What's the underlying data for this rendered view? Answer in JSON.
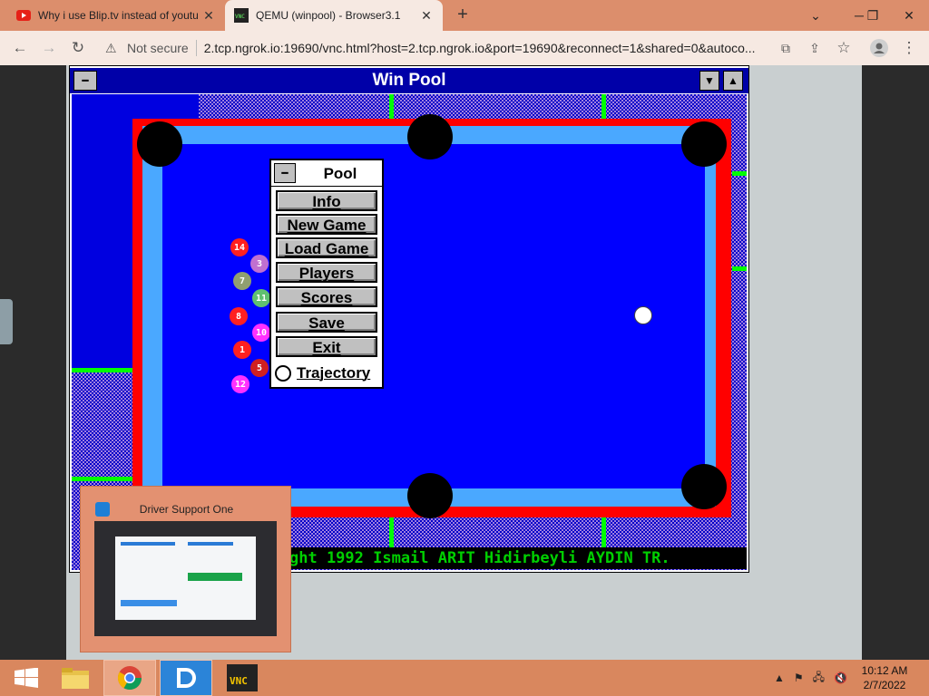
{
  "browser": {
    "tabs": [
      {
        "title": "Why i use Blip.tv instead of youtu",
        "favicon": "youtube-icon",
        "active": false
      },
      {
        "title": "QEMU (winpool) - Browser3.1",
        "favicon": "vnc-icon",
        "active": true
      }
    ],
    "security_label": "Not secure",
    "url": "2.tcp.ngrok.io:19690/vnc.html?host=2.tcp.ngrok.io&port=19690&reconnect=1&shared=0&autoco..."
  },
  "winpool": {
    "title": "Win Pool",
    "ticker": "ght 1992 Ismail ARIT Hidirbeyli AYDIN TR.",
    "menu": {
      "title": "Pool",
      "buttons": [
        "Info",
        "New Game",
        "Load Game",
        "Players",
        "Scores",
        "Save",
        "Exit"
      ],
      "trajectory_label": "Trajectory"
    },
    "balls": [
      {
        "num": "14",
        "color": "#ff2020"
      },
      {
        "num": "3",
        "color": "#c070d0"
      },
      {
        "num": "7",
        "color": "#90a070"
      },
      {
        "num": "11",
        "color": "#60c070"
      },
      {
        "num": "8",
        "color": "#ff2020"
      },
      {
        "num": "10",
        "color": "#ff30ff"
      },
      {
        "num": "1",
        "color": "#ff2020"
      },
      {
        "num": "5",
        "color": "#d02020"
      },
      {
        "num": "12",
        "color": "#ff30ff"
      },
      {
        "num": "",
        "color": "#ffffff"
      }
    ]
  },
  "popup": {
    "title": "Driver Support One"
  },
  "taskbar": {
    "items": [
      "start-icon",
      "file-explorer-icon",
      "chrome-icon",
      "driver-support-icon",
      "vnc-icon"
    ],
    "time": "10:12 AM",
    "date": "2/7/2022"
  }
}
